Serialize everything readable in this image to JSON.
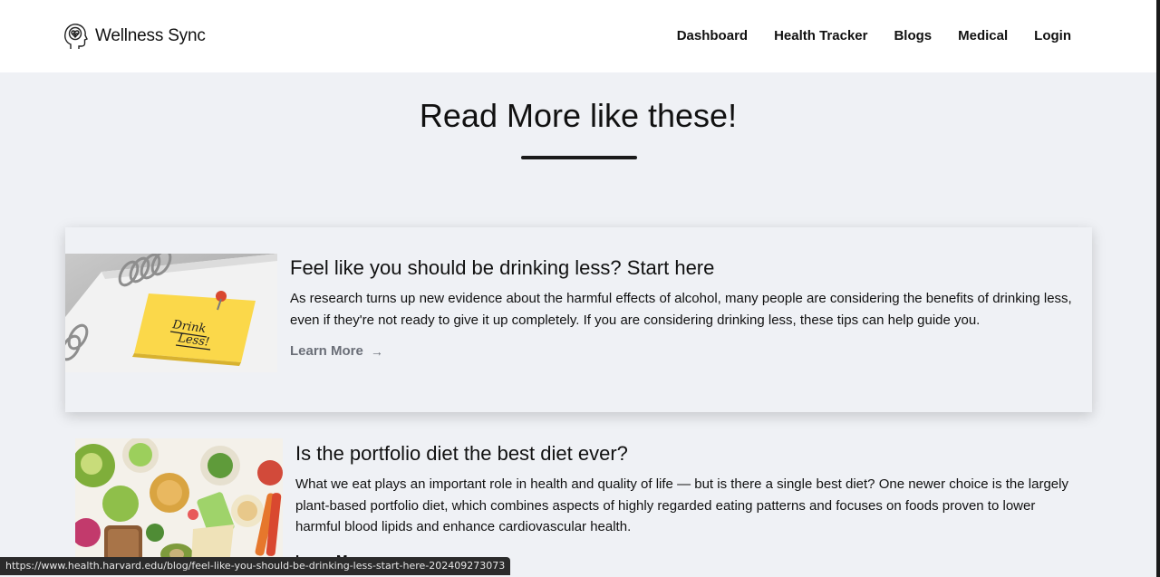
{
  "header": {
    "brand_name": "Wellness Sync",
    "nav": [
      "Dashboard",
      "Health Tracker",
      "Blogs",
      "Medical",
      "Login"
    ]
  },
  "section": {
    "title": "Read More like these!"
  },
  "articles": [
    {
      "title": "Feel like you should be drinking less? Start here",
      "text": "As research turns up new evidence about the harmful effects of alcohol, many people are considering the benefits of drinking less, even if they're not ready to give it up completely. If you are considering drinking less, these tips can help guide you.",
      "link_label": "Learn More",
      "image_note_text": "Drink Less!"
    },
    {
      "title": "Is the portfolio diet the best diet ever?",
      "text": "What we eat plays an important role in health and quality of life — but is there a single best diet? One newer choice is the largely plant-based portfolio diet, which combines aspects of highly regarded eating patterns and focuses on foods proven to lower harmful blood lipids and enhance cardiovascular health.",
      "link_label": "Learn More"
    }
  ],
  "status_bar": {
    "url": "https://www.health.harvard.edu/blog/feel-like-you-should-be-drinking-less-start-here-202409273073"
  },
  "colors": {
    "page_bg": "#eff1f5",
    "header_bg": "#ffffff",
    "text": "#111111",
    "muted_link": "#6b6f78"
  }
}
